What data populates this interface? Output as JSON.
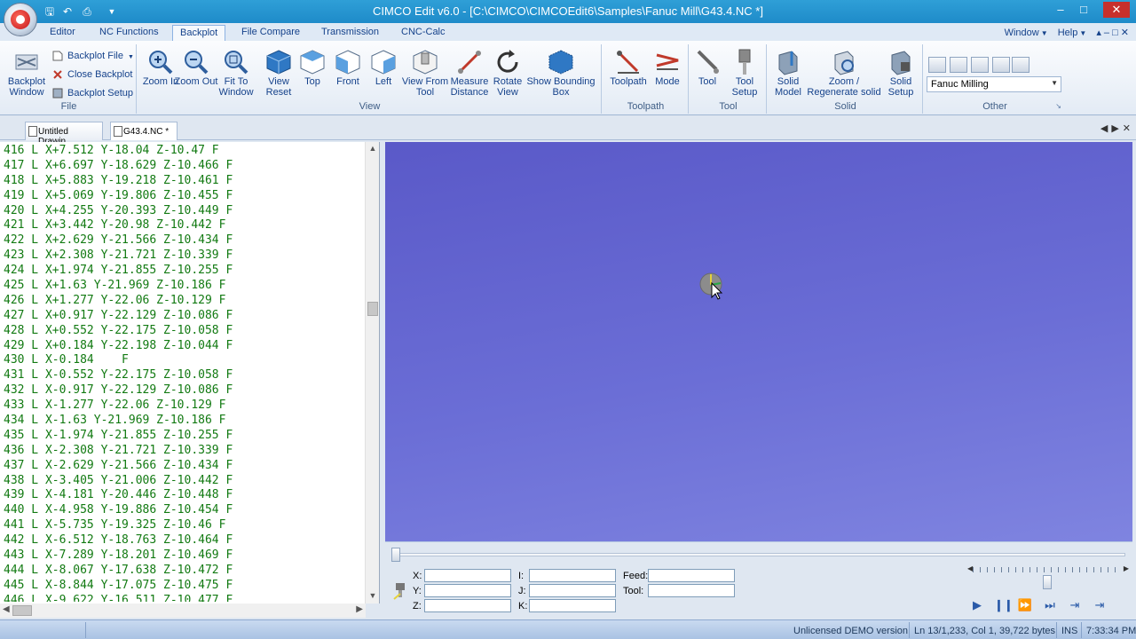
{
  "app": {
    "title": "CIMCO Edit v6.0 - [C:\\CIMCO\\CIMCOEdit6\\Samples\\Fanuc Mill\\G43.4.NC *]",
    "window_controls": [
      "–",
      "□",
      "✕"
    ]
  },
  "ribbon_tabs": [
    "Editor",
    "NC Functions",
    "Backplot",
    "File Compare",
    "Transmission",
    "CNC-Calc"
  ],
  "active_tab": "Backplot",
  "menu_right": {
    "window": "Window",
    "help": "Help",
    "controls": "▴ – □ ✕"
  },
  "ribbon": {
    "file": {
      "label": "File",
      "backplot_window": "Backplot Window",
      "backplot_file": "Backplot File",
      "close_backplot": "Close Backplot",
      "backplot_setup": "Backplot Setup"
    },
    "view": {
      "label": "View",
      "zoom_in": "Zoom In",
      "zoom_out": "Zoom Out",
      "fit_to_window": "Fit To Window",
      "view_reset": "View Reset",
      "top": "Top",
      "front": "Front",
      "left": "Left",
      "view_from_tool": "View From Tool",
      "measure_distance": "Measure Distance",
      "rotate_view": "Rotate View",
      "show_bounding_box": "Show Bounding Box"
    },
    "toolpath": {
      "label": "Toolpath",
      "toolpath": "Toolpath",
      "mode": "Mode"
    },
    "tool": {
      "label": "Tool",
      "tool": "Tool",
      "tool_setup": "Tool Setup"
    },
    "solid": {
      "label": "Solid",
      "solid_model": "Solid Model",
      "zoom_regenerate": "Zoom / Regenerate solid",
      "solid_setup": "Solid Setup"
    },
    "other": {
      "label": "Other",
      "machine": "Fanuc Milling"
    }
  },
  "doc_tabs": [
    "Untitled Drawin",
    "G43.4.NC *"
  ],
  "code_lines": [
    "416 L X+7.512 Y-18.04 Z-10.47 F",
    "417 L X+6.697 Y-18.629 Z-10.466 F",
    "418 L X+5.883 Y-19.218 Z-10.461 F",
    "419 L X+5.069 Y-19.806 Z-10.455 F",
    "420 L X+4.255 Y-20.393 Z-10.449 F",
    "421 L X+3.442 Y-20.98 Z-10.442 F",
    "422 L X+2.629 Y-21.566 Z-10.434 F",
    "423 L X+2.308 Y-21.721 Z-10.339 F",
    "424 L X+1.974 Y-21.855 Z-10.255 F",
    "425 L X+1.63 Y-21.969 Z-10.186 F",
    "426 L X+1.277 Y-22.06 Z-10.129 F",
    "427 L X+0.917 Y-22.129 Z-10.086 F",
    "428 L X+0.552 Y-22.175 Z-10.058 F",
    "429 L X+0.184 Y-22.198 Z-10.044 F",
    "430 L X-0.184    F",
    "431 L X-0.552 Y-22.175 Z-10.058 F",
    "432 L X-0.917 Y-22.129 Z-10.086 F",
    "433 L X-1.277 Y-22.06 Z-10.129 F",
    "434 L X-1.63 Y-21.969 Z-10.186 F",
    "435 L X-1.974 Y-21.855 Z-10.255 F",
    "436 L X-2.308 Y-21.721 Z-10.339 F",
    "437 L X-2.629 Y-21.566 Z-10.434 F",
    "438 L X-3.405 Y-21.006 Z-10.442 F",
    "439 L X-4.181 Y-20.446 Z-10.448 F",
    "440 L X-4.958 Y-19.886 Z-10.454 F",
    "441 L X-5.735 Y-19.325 Z-10.46 F",
    "442 L X-6.512 Y-18.763 Z-10.464 F",
    "443 L X-7.289 Y-18.201 Z-10.469 F",
    "444 L X-8.067 Y-17.638 Z-10.472 F",
    "445 L X-8.844 Y-17.075 Z-10.475 F",
    "446 L X-9.622 Y-16.511 Z-10.477 F"
  ],
  "sim": {
    "labels": {
      "x": "X:",
      "y": "Y:",
      "z": "Z:",
      "i": "I:",
      "j": "J:",
      "k": "K:",
      "feed": "Feed:",
      "tool": "Tool:"
    },
    "values": {
      "x": "",
      "y": "",
      "z": "",
      "i": "",
      "j": "",
      "k": "",
      "feed": "",
      "tool": ""
    },
    "progress": 0.0,
    "speed": 0.5
  },
  "status": {
    "license": "Unlicensed DEMO version",
    "position": "Ln 13/1,233, Col 1, 39,722 bytes",
    "mode": "INS",
    "time": "7:33:34 PM"
  },
  "colors": {
    "titlebar": "#1e8bc9",
    "viewport": "#6b6ed6",
    "code": "#127a12"
  }
}
